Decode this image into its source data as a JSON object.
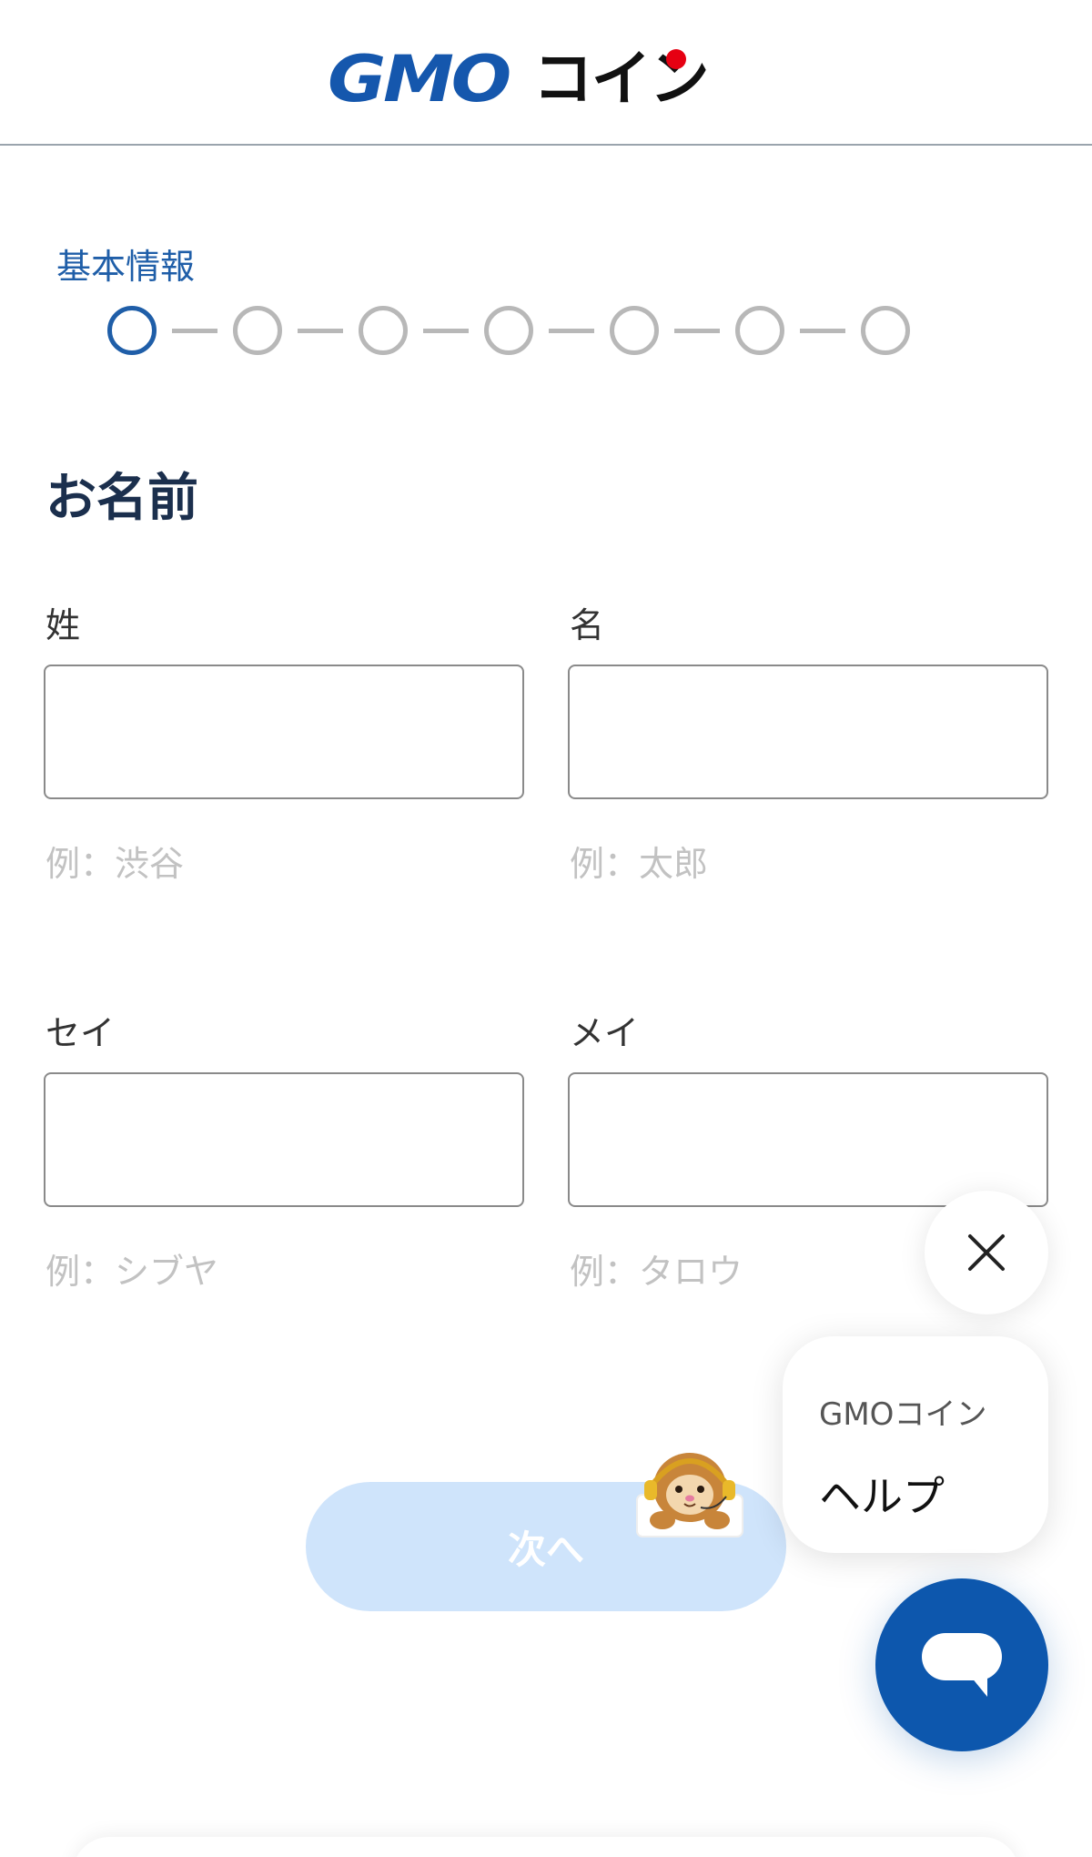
{
  "header": {
    "logo_latin": "GMO",
    "logo_kana": "コイン",
    "brand_red": "#e60012",
    "brand_blue": "#1557ad"
  },
  "progress": {
    "step_label": "基本情報",
    "total_steps": 7,
    "current_step": 1,
    "active_color": "#1f5ea8"
  },
  "form": {
    "section_title": "お名前",
    "fields": [
      {
        "label": "姓",
        "value": "",
        "hint": "例：渋谷"
      },
      {
        "label": "名",
        "value": "",
        "hint": "例：太郎"
      },
      {
        "label": "セイ",
        "value": "",
        "hint": "例：シブヤ"
      },
      {
        "label": "メイ",
        "value": "",
        "hint": "例：タロウ"
      }
    ],
    "next_label": "次へ"
  },
  "help_widget": {
    "brand": "GMOコイン",
    "title": "ヘルプ",
    "close_icon": "close-icon",
    "chat_icon": "chat-bubble-icon",
    "chat_color": "#0d57ad"
  }
}
